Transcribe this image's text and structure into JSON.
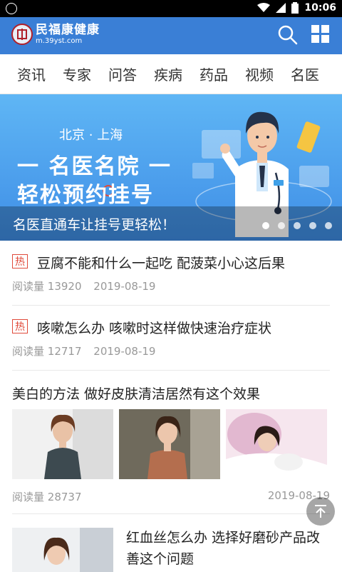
{
  "status_bar": {
    "time": "10:06",
    "battery_icon": "battery-icon",
    "wifi_icon": "wifi-icon",
    "signal_icon": "signal-icon"
  },
  "header": {
    "brand_name": "民福康健康",
    "brand_url": "m.39yst.com",
    "search_icon": "search-icon",
    "menu_icon": "grid-menu-icon",
    "bg_color": "#3a7fd6"
  },
  "tabs": [
    "资讯",
    "专家",
    "问答",
    "疾病",
    "药品",
    "视频",
    "名医"
  ],
  "banner": {
    "cities": "北京 · 上海",
    "headline1": "一 名医名院 一",
    "headline2": "轻松预约挂号",
    "caption": "名医直通车让挂号更轻松！",
    "dots_count": 5,
    "active_dot": 0
  },
  "feed": [
    {
      "hot_tag": "热",
      "title": "豆腐不能和什么一起吃 配菠菜小心这后果",
      "read_label": "阅读量",
      "reads": "13920",
      "date": "2019-08-19"
    },
    {
      "hot_tag": "热",
      "title": "咳嗽怎么办 咳嗽时这样做快速治疗症状",
      "read_label": "阅读量",
      "reads": "12717",
      "date": "2019-08-19"
    },
    {
      "title": "美白的方法 做好皮肤清洁居然有这个效果",
      "read_label": "阅读量",
      "reads": "28737",
      "date": "2019-08-19"
    },
    {
      "title": "红血丝怎么办 选择好磨砂产品改善这个问题"
    }
  ],
  "colors": {
    "hot": "#e04a3a",
    "meta": "#999999"
  },
  "back_to_top_icon": "arrow-up-to-top-icon"
}
